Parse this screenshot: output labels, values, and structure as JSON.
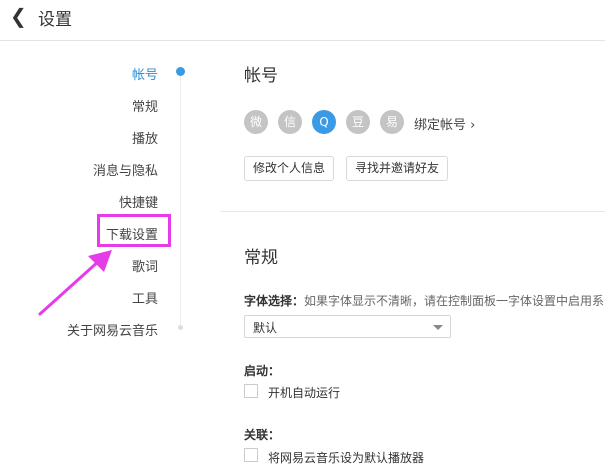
{
  "header": {
    "title": "设置"
  },
  "nav": {
    "items": [
      {
        "label": "帐号",
        "active": true
      },
      {
        "label": "常规"
      },
      {
        "label": "播放"
      },
      {
        "label": "消息与隐私"
      },
      {
        "label": "快捷键"
      },
      {
        "label": "下载设置"
      },
      {
        "label": "歌词"
      },
      {
        "label": "工具"
      },
      {
        "label": "关于网易云音乐"
      }
    ]
  },
  "account": {
    "title": "帐号",
    "social": [
      {
        "icon": "weibo-icon",
        "glyph": "微"
      },
      {
        "icon": "wechat-icon",
        "glyph": "信"
      },
      {
        "icon": "qq-icon",
        "glyph": "Q"
      },
      {
        "icon": "douban-icon",
        "glyph": "豆"
      },
      {
        "icon": "yixin-icon",
        "glyph": "易"
      }
    ],
    "bind_label": "绑定帐号 ›",
    "edit_profile": "修改个人信息",
    "find_friends": "寻找并邀请好友"
  },
  "general": {
    "title": "常规",
    "font_label": "字体选择：",
    "font_hint": "如果字体显示不清晰，请在控制面板一字体设置中启用系",
    "font_value": "默认",
    "startup_label": "启动：",
    "autostart_label": "开机自动运行",
    "assoc_label": "关联：",
    "assoc_option": "将网易云音乐设为默认播放器"
  },
  "colors": {
    "accent": "#3b9ae4",
    "highlight": "#e63be8"
  }
}
